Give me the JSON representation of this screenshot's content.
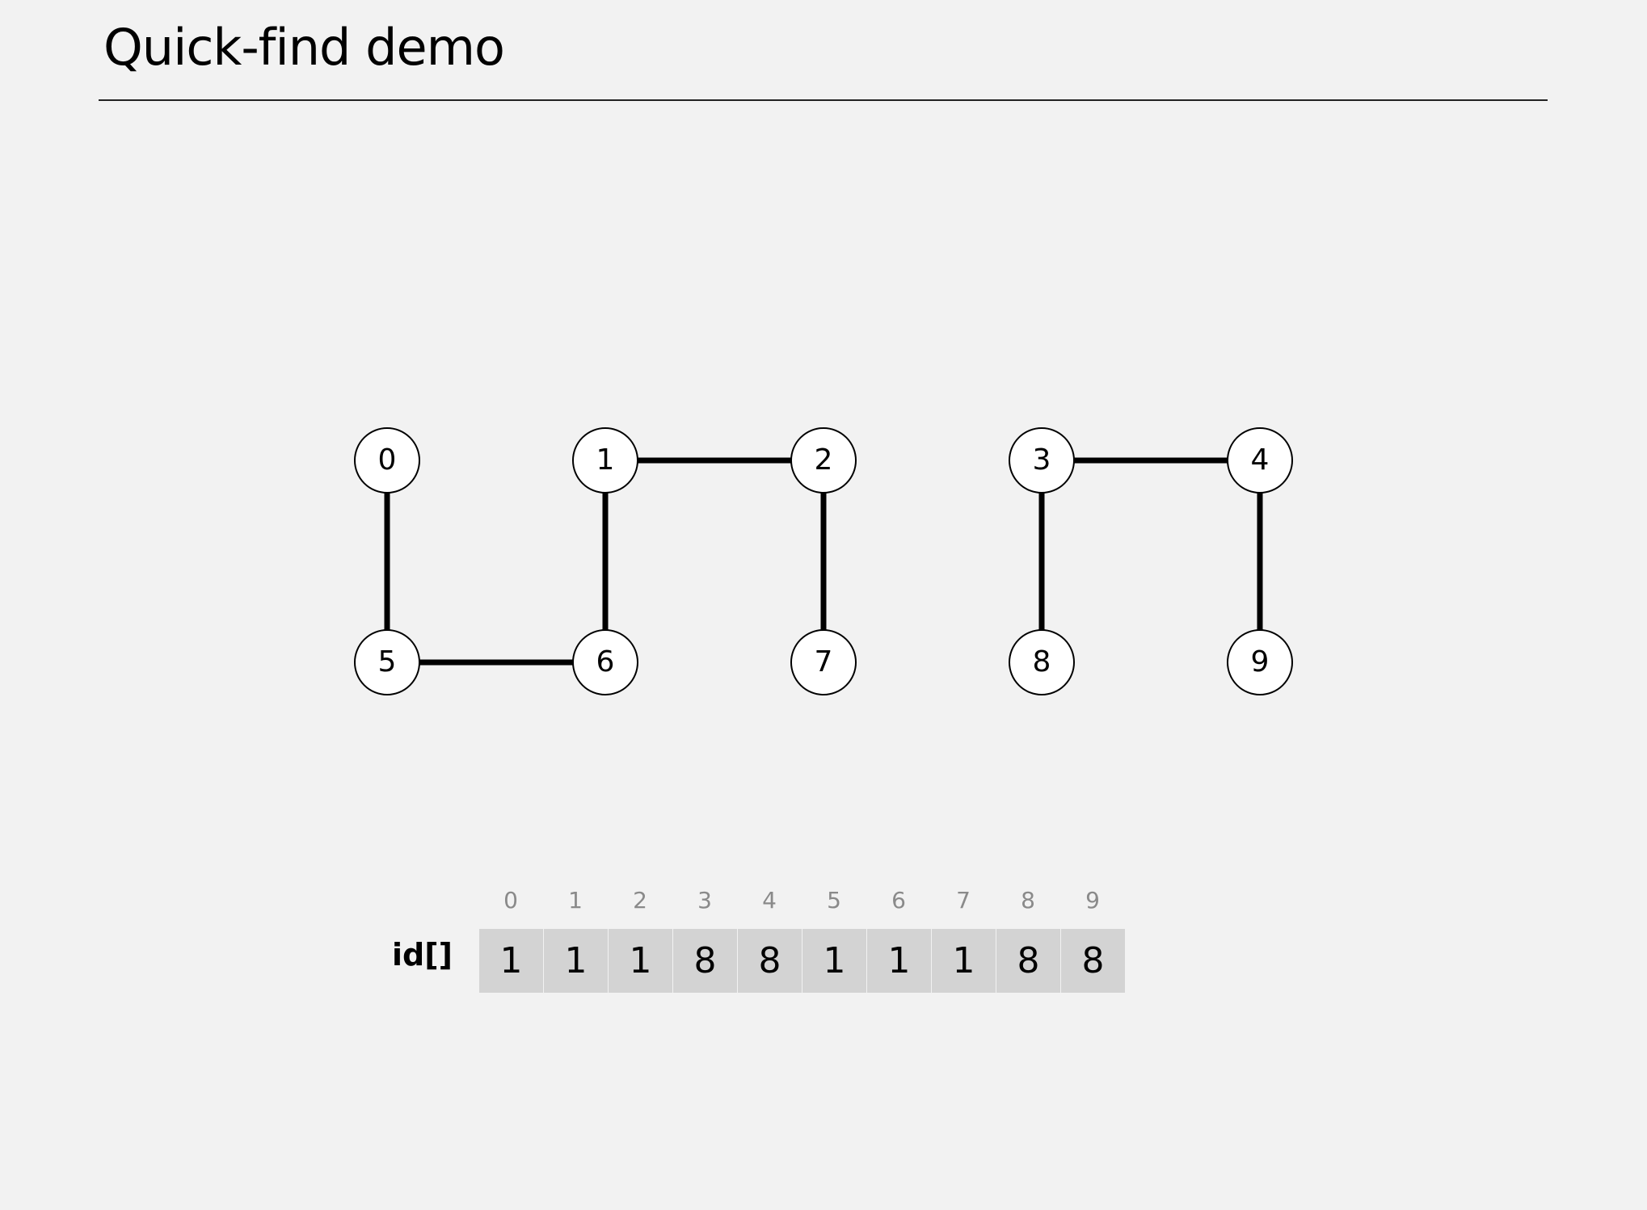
{
  "title": "Quick-find demo",
  "graph": {
    "nodes": [
      "0",
      "1",
      "2",
      "3",
      "4",
      "5",
      "6",
      "7",
      "8",
      "9"
    ],
    "edges": [
      [
        "0",
        "5"
      ],
      [
        "5",
        "6"
      ],
      [
        "1",
        "6"
      ],
      [
        "1",
        "2"
      ],
      [
        "2",
        "7"
      ],
      [
        "3",
        "4"
      ],
      [
        "3",
        "8"
      ],
      [
        "4",
        "9"
      ]
    ]
  },
  "array": {
    "name": "id[]",
    "indices": [
      "0",
      "1",
      "2",
      "3",
      "4",
      "5",
      "6",
      "7",
      "8",
      "9"
    ],
    "values": [
      "1",
      "1",
      "1",
      "8",
      "8",
      "1",
      "1",
      "1",
      "8",
      "8"
    ]
  }
}
